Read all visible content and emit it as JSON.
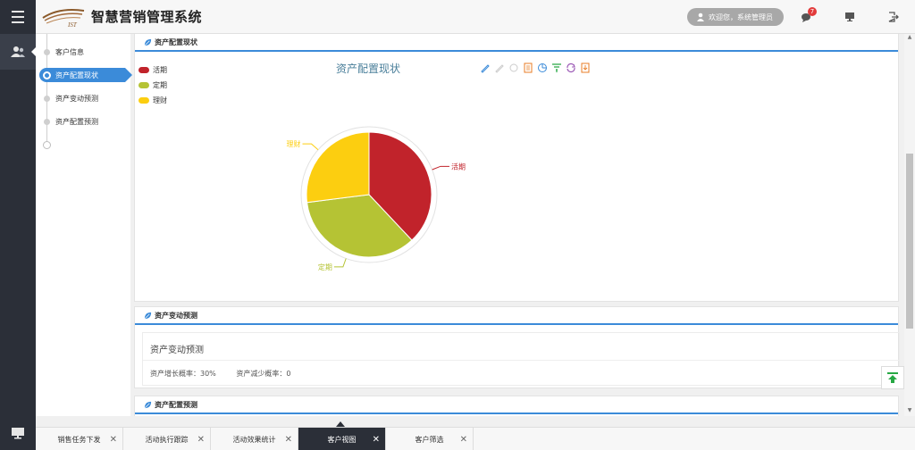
{
  "header": {
    "app_title": "智慧营销管理系统",
    "logo_text": "IST",
    "user_greeting": "欢迎您，系统管理员",
    "message_badge": "7"
  },
  "subnav": {
    "items": [
      {
        "label": "客户信息"
      },
      {
        "label": "资产配置现状"
      },
      {
        "label": "资产变动预测"
      },
      {
        "label": "资产配置预测"
      }
    ],
    "active_index": 1
  },
  "panels": {
    "asset_status": {
      "title": "资产配置现状",
      "chart_title": "资产配置现状"
    },
    "asset_forecast": {
      "title": "资产变动预测",
      "card_title": "资产变动预测",
      "growth_label": "资产增长概率：",
      "growth_value": "30%",
      "decrease_label": "资产减少概率：",
      "decrease_value": "0"
    },
    "allocation_forecast": {
      "title": "资产配置预测"
    }
  },
  "chart_data": {
    "type": "pie",
    "title": "资产配置现状",
    "legend_position": "top-left",
    "series": [
      {
        "name": "活期",
        "value": 38,
        "color": "#c1232b"
      },
      {
        "name": "定期",
        "value": 35,
        "color": "#b5c334"
      },
      {
        "name": "理财",
        "value": 27,
        "color": "#fcce10"
      }
    ]
  },
  "tabs": [
    {
      "label": "销售任务下发"
    },
    {
      "label": "活动执行跟踪"
    },
    {
      "label": "活动效果统计"
    },
    {
      "label": "客户视图",
      "active": true
    },
    {
      "label": "客户筛选"
    }
  ]
}
